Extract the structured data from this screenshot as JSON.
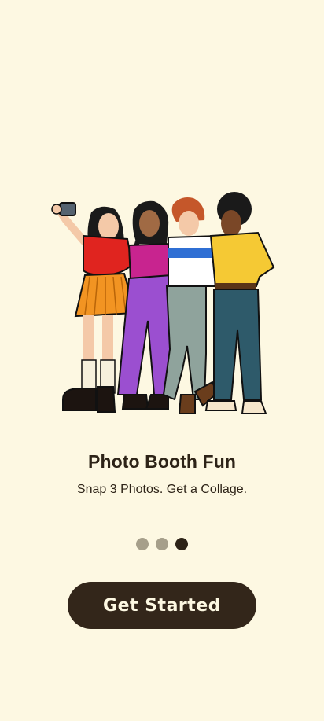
{
  "onboarding": {
    "title": "Photo Booth Fun",
    "subtitle": "Snap 3 Photos. Get a Collage.",
    "pagination": {
      "total": 3,
      "active": 3
    },
    "cta_label": "Get Started"
  },
  "colors": {
    "background": "#fdf8e2",
    "text": "#2d2317",
    "button": "#33261a",
    "dot_inactive": "#a69f8a",
    "dot_active": "#2d2317"
  }
}
